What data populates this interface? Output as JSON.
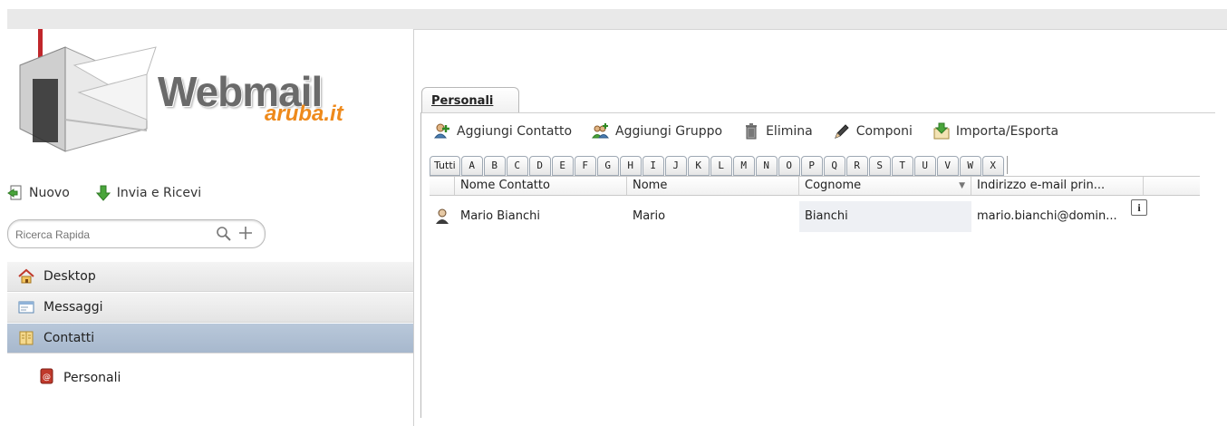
{
  "logo": {
    "word": "Webmail",
    "sub": "aruba.it"
  },
  "actions": {
    "new_label": "Nuovo",
    "send_receive_label": "Invia e Ricevi"
  },
  "search": {
    "placeholder": "Ricerca Rapida"
  },
  "nav": {
    "items": [
      {
        "label": "Desktop",
        "icon": "home-icon"
      },
      {
        "label": "Messaggi",
        "icon": "messages-icon"
      },
      {
        "label": "Contatti",
        "icon": "address-book-icon",
        "active": true
      }
    ],
    "subitems": [
      {
        "label": "Personali",
        "icon": "personal-book-icon"
      }
    ]
  },
  "tab": {
    "label": "Personali"
  },
  "toolbar": {
    "add_contact": "Aggiungi Contatto",
    "add_group": "Aggiungi Gruppo",
    "delete": "Elimina",
    "compose": "Componi",
    "import_export": "Importa/Esporta"
  },
  "alphabet": [
    "Tutti",
    "A",
    "B",
    "C",
    "D",
    "E",
    "F",
    "G",
    "H",
    "I",
    "J",
    "K",
    "L",
    "M",
    "N",
    "O",
    "P",
    "Q",
    "R",
    "S",
    "T",
    "U",
    "V",
    "W",
    "X"
  ],
  "grid": {
    "columns": [
      "Nome Contatto",
      "Nome",
      "Cognome",
      "Indirizzo e-mail prin..."
    ],
    "rows": [
      {
        "contact_name": "Mario Bianchi",
        "first_name": "Mario",
        "last_name": "Bianchi",
        "email": "mario.bianchi@domin..."
      }
    ]
  },
  "colors": {
    "accent_orange": "#ee8a1c",
    "active_nav": "#adbdd0"
  }
}
